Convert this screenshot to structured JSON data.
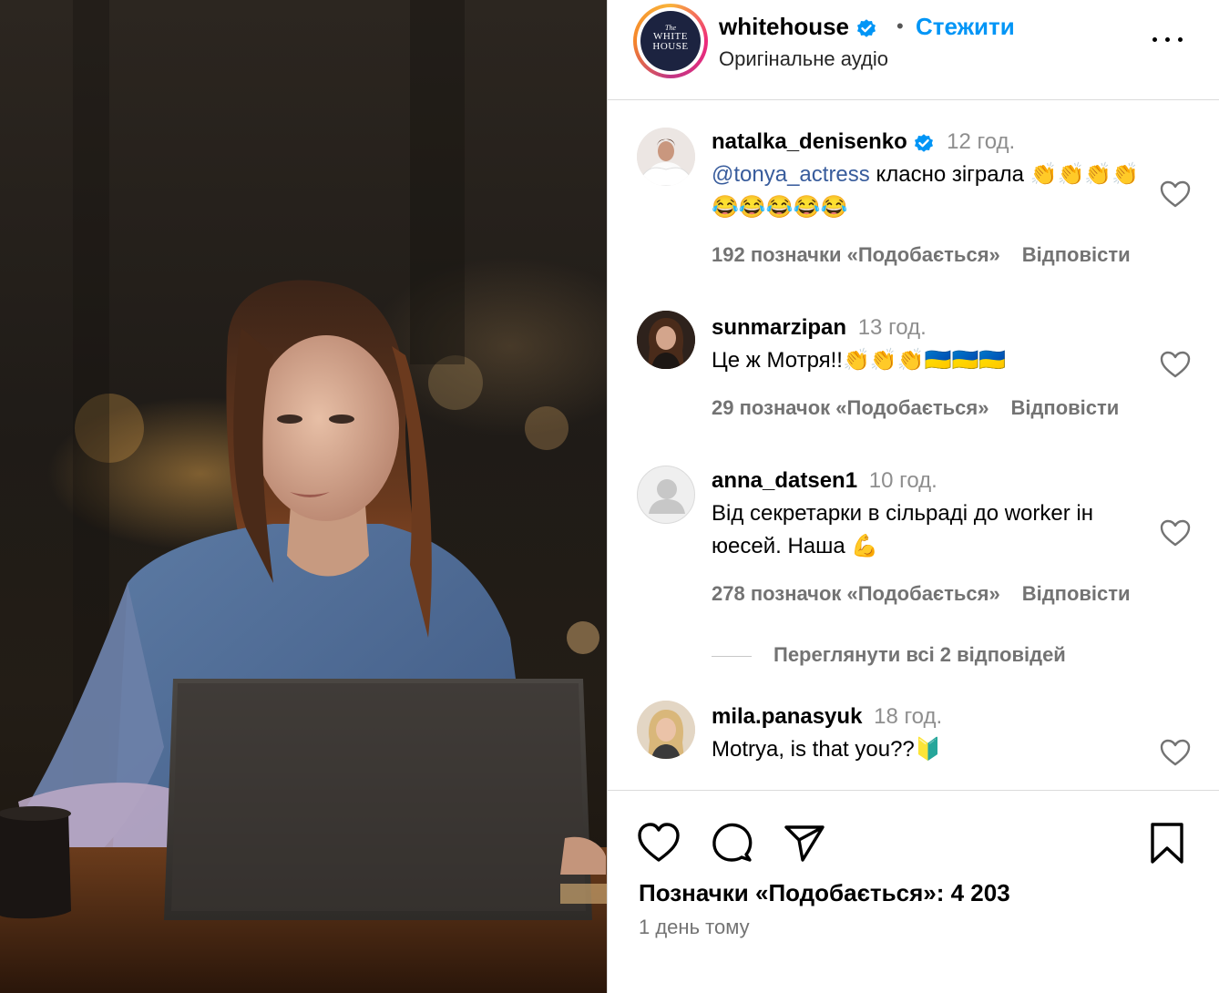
{
  "header": {
    "username": "whitehouse",
    "separator": "•",
    "follow_label": "Стежити",
    "audio_label": "Оригінальне аудіо",
    "logo_small": "The",
    "logo_line1": "WHITE",
    "logo_line2": "HOUSE"
  },
  "comments": [
    {
      "username": "natalka_denisenko",
      "verified": true,
      "time": "12 год.",
      "mention": "@tonya_actress",
      "text": " класно зіграла 👏👏👏👏😂😂😂😂😂",
      "likes_label": "192 позначки «Подобається»",
      "reply_label": "Відповісти"
    },
    {
      "username": "sunmarzipan",
      "time": "13 год.",
      "text": "Це ж Мотря!!👏👏👏🇺🇦🇺🇦🇺🇦",
      "likes_label": "29 позначок «Подобається»",
      "reply_label": "Відповісти"
    },
    {
      "username": "anna_datsen1",
      "time": "10 год.",
      "text": "Від секретарки в сільраді до worker ін юесей. Наша 💪",
      "likes_label": "278 позначок «Подобається»",
      "reply_label": "Відповісти"
    },
    {
      "username": "mila.panasyuk",
      "time": "18 год.",
      "text": "Motrya, is that you??🔰",
      "likes_label": "",
      "reply_label": ""
    }
  ],
  "view_replies_label": "Переглянути всі 2 відповідей",
  "footer": {
    "likes_label": "Позначки «Подобається»: 4 203",
    "time_ago": "1 день тому"
  },
  "colors": {
    "link_blue": "#0095f6",
    "verified_blue": "#0095f6",
    "mention": "#385c9c",
    "muted": "#737373"
  }
}
